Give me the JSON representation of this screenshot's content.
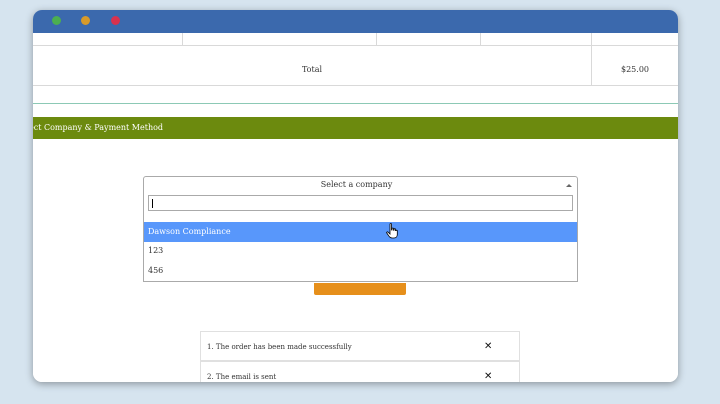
{
  "window": {
    "controls": [
      "green-dot",
      "amber-dot",
      "red-dot"
    ],
    "titlebar_color": "#3b69ad"
  },
  "order_table": {
    "total_label": "Total",
    "total_value": "$25.00"
  },
  "section": {
    "title": "ect Company & Payment Method",
    "bar_color": "#6c8a0e"
  },
  "company_select": {
    "selected_label": "Select a company",
    "search_value": "",
    "options": [
      "Dawson Compliance",
      "123",
      "456"
    ],
    "highlighted_option": "Dawson Compliance",
    "highlight_color": "#5897fb"
  },
  "submit_button": {
    "color": "#e68f1b"
  },
  "notifications": [
    {
      "message": "1. The order has been made successfully",
      "close": "✕"
    },
    {
      "message": "2. The email is sent",
      "close": "✕"
    }
  ]
}
